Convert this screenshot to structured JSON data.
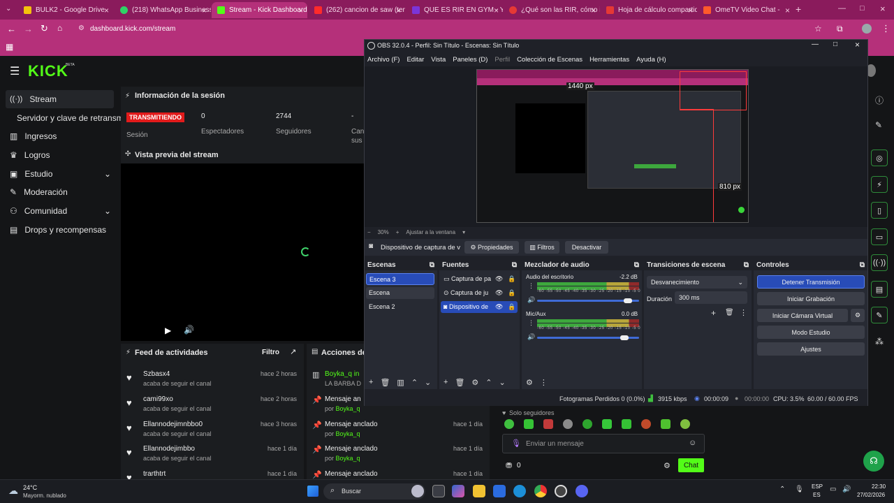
{
  "browser": {
    "tabs": [
      {
        "label": "BULK2 - Google Drive",
        "color": "#f4c20d"
      },
      {
        "label": "(218) WhatsApp Business",
        "color": "#2fd366"
      },
      {
        "label": "Stream - Kick Dashboard",
        "color": "#53fc18"
      },
      {
        "label": "(262) cancion de saw (tem",
        "color": "#ff2b2b"
      },
      {
        "label": "QUE ES RIR EN GYM - Yah",
        "color": "#7b35d8"
      },
      {
        "label": "¿Qué son las RIR, cómo in",
        "color": "#e53935"
      },
      {
        "label": "Hoja de cálculo compartid",
        "color": "#e53935"
      },
      {
        "label": "OmeTV Video Chat -",
        "color": "#ff5a2b"
      }
    ],
    "url": "dashboard.kick.com/stream"
  },
  "kick": {
    "logo": "KICK",
    "beta": "BETA",
    "nav": [
      {
        "label": "Stream"
      },
      {
        "label": "Servidor y clave de retransmisión"
      },
      {
        "label": "Ingresos"
      },
      {
        "label": "Logros"
      },
      {
        "label": "Estudio"
      },
      {
        "label": "Moderación"
      },
      {
        "label": "Comunidad"
      },
      {
        "label": "Drops y recompensas"
      }
    ],
    "session": {
      "title": "Información de la sesión",
      "live_badge": "TRANSMITIENDO",
      "session_label": "Sesión",
      "viewers_value": "0",
      "viewers_label": "Espectadores",
      "followers_value": "2744",
      "followers_label": "Seguidores",
      "cut_value": "-",
      "cut_label_1": "Can",
      "cut_label_2": "sus"
    },
    "preview": {
      "title": "Vista previa del stream"
    },
    "feed": {
      "title": "Feed de actividades",
      "filter": "Filtro",
      "rows": [
        {
          "name": "Szbasx4",
          "action": "acaba de seguir el canal",
          "time": "hace 2 horas"
        },
        {
          "name": "cami99xo",
          "action": "acaba de seguir el canal",
          "time": "hace 2 horas"
        },
        {
          "name": "Ellannodejimnbbo0",
          "action": "acaba de seguir el canal",
          "time": "hace 3 horas"
        },
        {
          "name": "Ellannodejimbbo",
          "action": "acaba de seguir el canal",
          "time": "hace 1 día"
        },
        {
          "name": "trarthtrt",
          "action": "",
          "time": "hace 1 día"
        }
      ]
    },
    "actions": {
      "title": "Acciones de m",
      "rows": [
        {
          "name": "Boyka_q in",
          "sub": "LA BARBA D",
          "time": ""
        },
        {
          "name": "Mensaje an",
          "by": "por",
          "user": "Boyka_q",
          "time": ""
        },
        {
          "name": "Mensaje anclado",
          "by": "por",
          "user": "Boyka_q",
          "time": "hace 1 día"
        },
        {
          "name": "Mensaje anclado",
          "by": "por",
          "user": "Boyka_q",
          "time": "hace 1 día"
        },
        {
          "name": "Mensaje anclado",
          "by": "",
          "user": "",
          "time": "hace 1 día"
        }
      ]
    },
    "chat": {
      "followers_only": "Solo seguidores",
      "placeholder": "Enviar un mensaje",
      "points": "0",
      "send": "Chat"
    }
  },
  "obs": {
    "title": "OBS 32.0.4 - Perfil: Sin Título - Escenas: Sin Título",
    "menu": [
      "Archivo (F)",
      "Editar",
      "Vista",
      "Paneles (D)",
      "Perfil",
      "Colección de Escenas",
      "Herramientas",
      "Ayuda (H)"
    ],
    "preview": {
      "label_w": "1440 px",
      "label_h": "810 px"
    },
    "zoom": "30%",
    "fit": "Ajustar a la ventana",
    "source_bar": {
      "name": "Dispositivo de captura de v",
      "properties": "Propiedades",
      "filters": "Filtros",
      "deactivate": "Desactivar"
    },
    "scenes": {
      "title": "Escenas",
      "items": [
        "Escena 3",
        "Escena",
        "Escena 2"
      ]
    },
    "sources": {
      "title": "Fuentes",
      "items": [
        "Captura de pa",
        "Captura de ju",
        "Dispositivo de"
      ]
    },
    "mixer": {
      "title": "Mezclador de audio",
      "channels": [
        {
          "name": "Audio del escritorio",
          "db": "-2.2 dB",
          "level": 0.93
        },
        {
          "name": "Mic/Aux",
          "db": "0.0 dB",
          "level": 0.9
        }
      ],
      "ticks": "-60 -55 -50 -45 -40 -35 -30 -25 -20 -15 -10 -5 0"
    },
    "transitions": {
      "title": "Transiciones de escena",
      "type": "Desvanecimiento",
      "duration_label": "Duración",
      "duration_value": "300 ms"
    },
    "controls": {
      "title": "Controles",
      "stop": "Detener Transmisión",
      "record": "Iniciar Grabación",
      "virtual_cam": "Iniciar Cámara Virtual",
      "studio": "Modo Estudio",
      "settings": "Ajustes"
    },
    "status": {
      "dropped": "Fotogramas Perdidos 0 (0.0%)",
      "kbps": "3915 kbps",
      "live_time": "00:00:09",
      "rec_time": "00:00:00",
      "cpu": "CPU: 3.5%",
      "fps": "60.00 / 60.00 FPS"
    }
  },
  "taskbar": {
    "weather_temp": "24°C",
    "weather_desc": "Mayorm. nublado",
    "search": "Buscar",
    "lang_1": "ESP",
    "lang_2": "ES",
    "time": "22:30",
    "date": "27/02/2026"
  }
}
